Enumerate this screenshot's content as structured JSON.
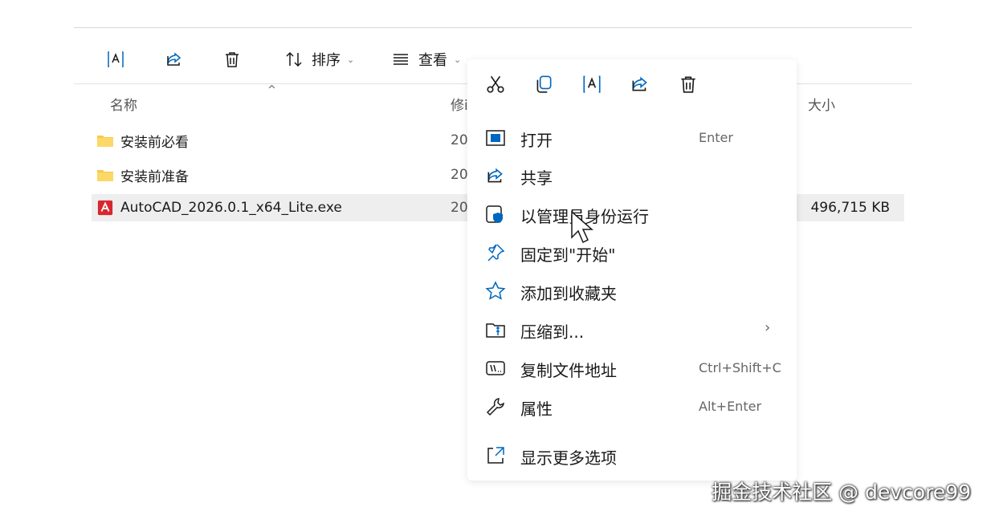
{
  "toolbar": {
    "sort_label": "排序",
    "view_label": "查看"
  },
  "columns": {
    "name": "名称",
    "modified": "修i",
    "size": "大小"
  },
  "files": [
    {
      "name": "安装前必看",
      "date": "20",
      "type": "folder"
    },
    {
      "name": "安装前准备",
      "date": "20",
      "type": "folder"
    },
    {
      "name": "AutoCAD_2026.0.1_x64_Lite.exe",
      "date": "20",
      "type": "exe",
      "size": "496,715 KB",
      "selected": true
    }
  ],
  "context_menu": {
    "quick_actions": [
      "cut-icon",
      "copy-icon",
      "rename-icon",
      "share-icon",
      "delete-icon"
    ],
    "items": [
      {
        "label": "打开",
        "shortcut": "Enter",
        "icon": "open-icon"
      },
      {
        "label": "共享",
        "shortcut": "",
        "icon": "share-icon"
      },
      {
        "label": "以管理员身份运行",
        "shortcut": "",
        "icon": "shield-icon"
      },
      {
        "label": "固定到\"开始\"",
        "shortcut": "",
        "icon": "pin-icon"
      },
      {
        "label": "添加到收藏夹",
        "shortcut": "",
        "icon": "star-icon"
      },
      {
        "label": "压缩到...",
        "shortcut": "",
        "icon": "zip-icon",
        "has_submenu": true
      },
      {
        "label": "复制文件地址",
        "shortcut": "Ctrl+Shift+C",
        "icon": "copy-path-icon"
      },
      {
        "label": "属性",
        "shortcut": "Alt+Enter",
        "icon": "wrench-icon"
      },
      {
        "label": "显示更多选项",
        "shortcut": "",
        "icon": "more-options-icon"
      }
    ]
  },
  "watermark": "掘金技术社区 @ devcore99",
  "colors": {
    "accent": "#0067c0",
    "folder": "#f7c948",
    "autocad": "#d8262f",
    "selection": "#eeeeee"
  }
}
